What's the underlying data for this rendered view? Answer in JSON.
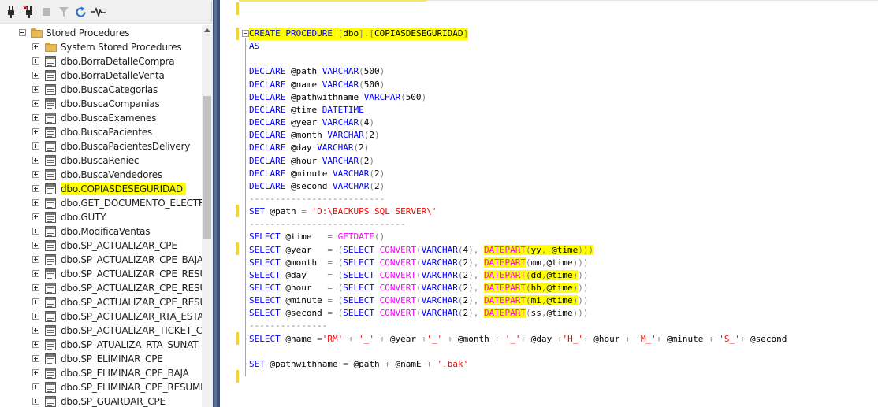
{
  "explorer": {
    "toolbar": {
      "icons": [
        "connect-icon",
        "disconnect-icon",
        "stop-icon",
        "filter-icon",
        "refresh-icon",
        "activity-monitor-icon"
      ]
    },
    "tree": {
      "root": {
        "label": "Stored Procedures",
        "expanded": true
      },
      "items": [
        {
          "label": "System Stored Procedures",
          "type": "folder",
          "highlighted": false
        },
        {
          "label": "dbo.BorraDetalleCompra",
          "type": "procedure",
          "highlighted": false
        },
        {
          "label": "dbo.BorraDetalleVenta",
          "type": "procedure",
          "highlighted": false
        },
        {
          "label": "dbo.BuscaCategorias",
          "type": "procedure",
          "highlighted": false
        },
        {
          "label": "dbo.BuscaCompanias",
          "type": "procedure",
          "highlighted": false
        },
        {
          "label": "dbo.BuscaExamenes",
          "type": "procedure",
          "highlighted": false
        },
        {
          "label": "dbo.BuscaPacientes",
          "type": "procedure",
          "highlighted": false
        },
        {
          "label": "dbo.BuscaPacientesDelivery",
          "type": "procedure",
          "highlighted": false
        },
        {
          "label": "dbo.BuscaReniec",
          "type": "procedure",
          "highlighted": false
        },
        {
          "label": "dbo.BuscaVendedores",
          "type": "procedure",
          "highlighted": false
        },
        {
          "label": "dbo.COPIASDESEGURIDAD",
          "type": "procedure",
          "highlighted": true
        },
        {
          "label": "dbo.GET_DOCUMENTO_ELECTRO",
          "type": "procedure",
          "highlighted": false
        },
        {
          "label": "dbo.GUTY",
          "type": "procedure",
          "highlighted": false
        },
        {
          "label": "dbo.ModificaVentas",
          "type": "procedure",
          "highlighted": false
        },
        {
          "label": "dbo.SP_ACTUALIZAR_CPE",
          "type": "procedure",
          "highlighted": false
        },
        {
          "label": "dbo.SP_ACTUALIZAR_CPE_BAJA",
          "type": "procedure",
          "highlighted": false
        },
        {
          "label": "dbo.SP_ACTUALIZAR_CPE_RESUM",
          "type": "procedure",
          "highlighted": false
        },
        {
          "label": "dbo.SP_ACTUALIZAR_CPE_RESUM",
          "type": "procedure",
          "highlighted": false
        },
        {
          "label": "dbo.SP_ACTUALIZAR_CPE_RESUM",
          "type": "procedure",
          "highlighted": false
        },
        {
          "label": "dbo.SP_ACTUALIZAR_RTA_ESTAD",
          "type": "procedure",
          "highlighted": false
        },
        {
          "label": "dbo.SP_ACTUALIZAR_TICKET_CPE",
          "type": "procedure",
          "highlighted": false
        },
        {
          "label": "dbo.SP_ATUALIZA_RTA_SUNAT_C",
          "type": "procedure",
          "highlighted": false
        },
        {
          "label": "dbo.SP_ELIMINAR_CPE",
          "type": "procedure",
          "highlighted": false
        },
        {
          "label": "dbo.SP_ELIMINAR_CPE_BAJA",
          "type": "procedure",
          "highlighted": false
        },
        {
          "label": "dbo.SP_ELIMINAR_CPE_RESUMEN",
          "type": "procedure",
          "highlighted": false
        },
        {
          "label": "dbo.SP_GUARDAR_CPE",
          "type": "procedure",
          "highlighted": false
        }
      ]
    }
  },
  "editor": {
    "colors": {
      "keyword": "#0000ff",
      "function": "#ff00ff",
      "string": "#ff0000",
      "operator": "#808080",
      "highlight": "#ffff00",
      "change_mark": "#f1d43a"
    },
    "lines": [
      {
        "highlight": true,
        "tokens": [
          [
            "kw",
            "CREATE PROCEDURE "
          ],
          [
            "op",
            "["
          ],
          [
            "var",
            "dbo"
          ],
          [
            "op",
            "]"
          ],
          [
            "op",
            "."
          ],
          [
            "op",
            "["
          ],
          [
            "var",
            "COPIASDESEGURIDAD"
          ],
          [
            "op",
            "]"
          ]
        ]
      },
      {
        "tokens": [
          [
            "kw",
            "AS"
          ]
        ]
      },
      {
        "tokens": []
      },
      {
        "tokens": [
          [
            "kw",
            "DECLARE "
          ],
          [
            "var",
            "@path "
          ],
          [
            "kw",
            "VARCHAR"
          ],
          [
            "op",
            "("
          ],
          [
            "var",
            "500"
          ],
          [
            "op",
            ")"
          ]
        ]
      },
      {
        "tokens": [
          [
            "kw",
            "DECLARE "
          ],
          [
            "var",
            "@name "
          ],
          [
            "kw",
            "VARCHAR"
          ],
          [
            "op",
            "("
          ],
          [
            "var",
            "500"
          ],
          [
            "op",
            ")"
          ]
        ]
      },
      {
        "tokens": [
          [
            "kw",
            "DECLARE "
          ],
          [
            "var",
            "@pathwithname "
          ],
          [
            "kw",
            "VARCHAR"
          ],
          [
            "op",
            "("
          ],
          [
            "var",
            "500"
          ],
          [
            "op",
            ")"
          ]
        ]
      },
      {
        "tokens": [
          [
            "kw",
            "DECLARE "
          ],
          [
            "var",
            "@time "
          ],
          [
            "kw",
            "DATETIME"
          ]
        ]
      },
      {
        "tokens": [
          [
            "kw",
            "DECLARE "
          ],
          [
            "var",
            "@year "
          ],
          [
            "kw",
            "VARCHAR"
          ],
          [
            "op",
            "("
          ],
          [
            "var",
            "4"
          ],
          [
            "op",
            ")"
          ]
        ]
      },
      {
        "tokens": [
          [
            "kw",
            "DECLARE "
          ],
          [
            "var",
            "@month "
          ],
          [
            "kw",
            "VARCHAR"
          ],
          [
            "op",
            "("
          ],
          [
            "var",
            "2"
          ],
          [
            "op",
            ")"
          ]
        ]
      },
      {
        "tokens": [
          [
            "kw",
            "DECLARE "
          ],
          [
            "var",
            "@day "
          ],
          [
            "kw",
            "VARCHAR"
          ],
          [
            "op",
            "("
          ],
          [
            "var",
            "2"
          ],
          [
            "op",
            ")"
          ]
        ]
      },
      {
        "tokens": [
          [
            "kw",
            "DECLARE "
          ],
          [
            "var",
            "@hour "
          ],
          [
            "kw",
            "VARCHAR"
          ],
          [
            "op",
            "("
          ],
          [
            "var",
            "2"
          ],
          [
            "op",
            ")"
          ]
        ]
      },
      {
        "tokens": [
          [
            "kw",
            "DECLARE "
          ],
          [
            "var",
            "@minute "
          ],
          [
            "kw",
            "VARCHAR"
          ],
          [
            "op",
            "("
          ],
          [
            "var",
            "2"
          ],
          [
            "op",
            ")"
          ]
        ]
      },
      {
        "tokens": [
          [
            "kw",
            "DECLARE "
          ],
          [
            "var",
            "@second "
          ],
          [
            "kw",
            "VARCHAR"
          ],
          [
            "op",
            "("
          ],
          [
            "var",
            "2"
          ],
          [
            "op",
            ")"
          ]
        ]
      },
      {
        "tokens": [
          [
            "op",
            "--------------------------"
          ]
        ]
      },
      {
        "tokens": [
          [
            "kw",
            "SET "
          ],
          [
            "var",
            "@path "
          ],
          [
            "op",
            "= "
          ],
          [
            "str",
            "'D:\\BACKUPS SQL SERVER\\'"
          ]
        ]
      },
      {
        "tokens": [
          [
            "op",
            "------------------------------"
          ]
        ]
      },
      {
        "tokens": [
          [
            "kw",
            "SELECT "
          ],
          [
            "var",
            "@time   "
          ],
          [
            "op",
            "= "
          ],
          [
            "fn",
            "GETDATE"
          ],
          [
            "op",
            "()"
          ]
        ]
      },
      {
        "tokens": [
          [
            "kw",
            "SELECT "
          ],
          [
            "var",
            "@year   "
          ],
          [
            "op",
            "= ("
          ],
          [
            "kw",
            "SELECT "
          ],
          [
            "fn",
            "CONVERT"
          ],
          [
            "op",
            "("
          ],
          [
            "kw",
            "VARCHAR"
          ],
          [
            "op",
            "("
          ],
          [
            "var",
            "4"
          ],
          [
            "op",
            "), "
          ],
          [
            "fnhl",
            "DATEPART"
          ],
          [
            "ophl",
            "("
          ],
          [
            "varhl",
            "yy"
          ],
          [
            "ophl",
            ", "
          ],
          [
            "varhl",
            "@time"
          ],
          [
            "ophl",
            ")))"
          ]
        ]
      },
      {
        "tokens": [
          [
            "kw",
            "SELECT "
          ],
          [
            "var",
            "@month  "
          ],
          [
            "op",
            "= ("
          ],
          [
            "kw",
            "SELECT "
          ],
          [
            "fn",
            "CONVERT"
          ],
          [
            "op",
            "("
          ],
          [
            "kw",
            "VARCHAR"
          ],
          [
            "op",
            "("
          ],
          [
            "var",
            "2"
          ],
          [
            "op",
            "), "
          ],
          [
            "fnhl",
            "DATEPART"
          ],
          [
            "op",
            "("
          ],
          [
            "var",
            "mm"
          ],
          [
            "op",
            ","
          ],
          [
            "var",
            "@time"
          ],
          [
            "op",
            ")))"
          ]
        ]
      },
      {
        "tokens": [
          [
            "kw",
            "SELECT "
          ],
          [
            "var",
            "@day    "
          ],
          [
            "op",
            "= ("
          ],
          [
            "kw",
            "SELECT "
          ],
          [
            "fn",
            "CONVERT"
          ],
          [
            "op",
            "("
          ],
          [
            "kw",
            "VARCHAR"
          ],
          [
            "op",
            "("
          ],
          [
            "var",
            "2"
          ],
          [
            "op",
            "), "
          ],
          [
            "fnhl",
            "DATEPART"
          ],
          [
            "ophl",
            "("
          ],
          [
            "varhl",
            "dd"
          ],
          [
            "ophl",
            ","
          ],
          [
            "varhl",
            "@time"
          ],
          [
            "ophl",
            ")"
          ],
          [
            "op",
            "))"
          ]
        ]
      },
      {
        "tokens": [
          [
            "kw",
            "SELECT "
          ],
          [
            "var",
            "@hour   "
          ],
          [
            "op",
            "= ("
          ],
          [
            "kw",
            "SELECT "
          ],
          [
            "fn",
            "CONVERT"
          ],
          [
            "op",
            "("
          ],
          [
            "kw",
            "VARCHAR"
          ],
          [
            "op",
            "("
          ],
          [
            "var",
            "2"
          ],
          [
            "op",
            "), "
          ],
          [
            "fnhl",
            "DATEPART"
          ],
          [
            "ophl",
            "("
          ],
          [
            "varhl",
            "hh"
          ],
          [
            "ophl",
            ","
          ],
          [
            "varhl",
            "@time"
          ],
          [
            "ophl",
            ")"
          ],
          [
            "op",
            "))"
          ]
        ]
      },
      {
        "tokens": [
          [
            "kw",
            "SELECT "
          ],
          [
            "var",
            "@minute "
          ],
          [
            "op",
            "= ("
          ],
          [
            "kw",
            "SELECT "
          ],
          [
            "fn",
            "CONVERT"
          ],
          [
            "op",
            "("
          ],
          [
            "kw",
            "VARCHAR"
          ],
          [
            "op",
            "("
          ],
          [
            "var",
            "2"
          ],
          [
            "op",
            "), "
          ],
          [
            "fnhl",
            "DATEPART"
          ],
          [
            "ophl",
            "("
          ],
          [
            "varhl",
            "mi"
          ],
          [
            "ophl",
            ","
          ],
          [
            "varhl",
            "@time"
          ],
          [
            "ophl",
            ")"
          ],
          [
            "op",
            "))"
          ]
        ]
      },
      {
        "tokens": [
          [
            "kw",
            "SELECT "
          ],
          [
            "var",
            "@second "
          ],
          [
            "op",
            "= ("
          ],
          [
            "kw",
            "SELECT "
          ],
          [
            "fn",
            "CONVERT"
          ],
          [
            "op",
            "("
          ],
          [
            "kw",
            "VARCHAR"
          ],
          [
            "op",
            "("
          ],
          [
            "var",
            "2"
          ],
          [
            "op",
            "), "
          ],
          [
            "fnhl",
            "DATEPART"
          ],
          [
            "op",
            "("
          ],
          [
            "var",
            "ss"
          ],
          [
            "op",
            ","
          ],
          [
            "var",
            "@time"
          ],
          [
            "op",
            ")))"
          ]
        ]
      },
      {
        "tokens": [
          [
            "op",
            "---------------"
          ]
        ]
      },
      {
        "tokens": [
          [
            "kw",
            "SELECT "
          ],
          [
            "var",
            "@name "
          ],
          [
            "op",
            "="
          ],
          [
            "str",
            "'RM'"
          ],
          [
            "op",
            " + "
          ],
          [
            "str",
            "'_'"
          ],
          [
            "op",
            " + "
          ],
          [
            "var",
            "@year "
          ],
          [
            "op",
            "+"
          ],
          [
            "str",
            "'_'"
          ],
          [
            "op",
            " + "
          ],
          [
            "var",
            "@month "
          ],
          [
            "op",
            "+ "
          ],
          [
            "str",
            "'_'"
          ],
          [
            "op",
            "+ "
          ],
          [
            "var",
            "@day "
          ],
          [
            "op",
            "+"
          ],
          [
            "str",
            "'H_'"
          ],
          [
            "op",
            "+ "
          ],
          [
            "var",
            "@hour "
          ],
          [
            "op",
            "+ "
          ],
          [
            "str",
            "'M_'"
          ],
          [
            "op",
            "+ "
          ],
          [
            "var",
            "@minute "
          ],
          [
            "op",
            "+ "
          ],
          [
            "str",
            "'S_'"
          ],
          [
            "op",
            "+ "
          ],
          [
            "var",
            "@second"
          ]
        ]
      },
      {
        "tokens": []
      },
      {
        "tokens": [
          [
            "kw",
            "SET "
          ],
          [
            "var",
            "@pathwithname "
          ],
          [
            "op",
            "= "
          ],
          [
            "var",
            "@path "
          ],
          [
            "op",
            "+ "
          ],
          [
            "var",
            "@namE "
          ],
          [
            "op",
            "+ "
          ],
          [
            "str",
            "'.bak'"
          ]
        ]
      }
    ]
  }
}
